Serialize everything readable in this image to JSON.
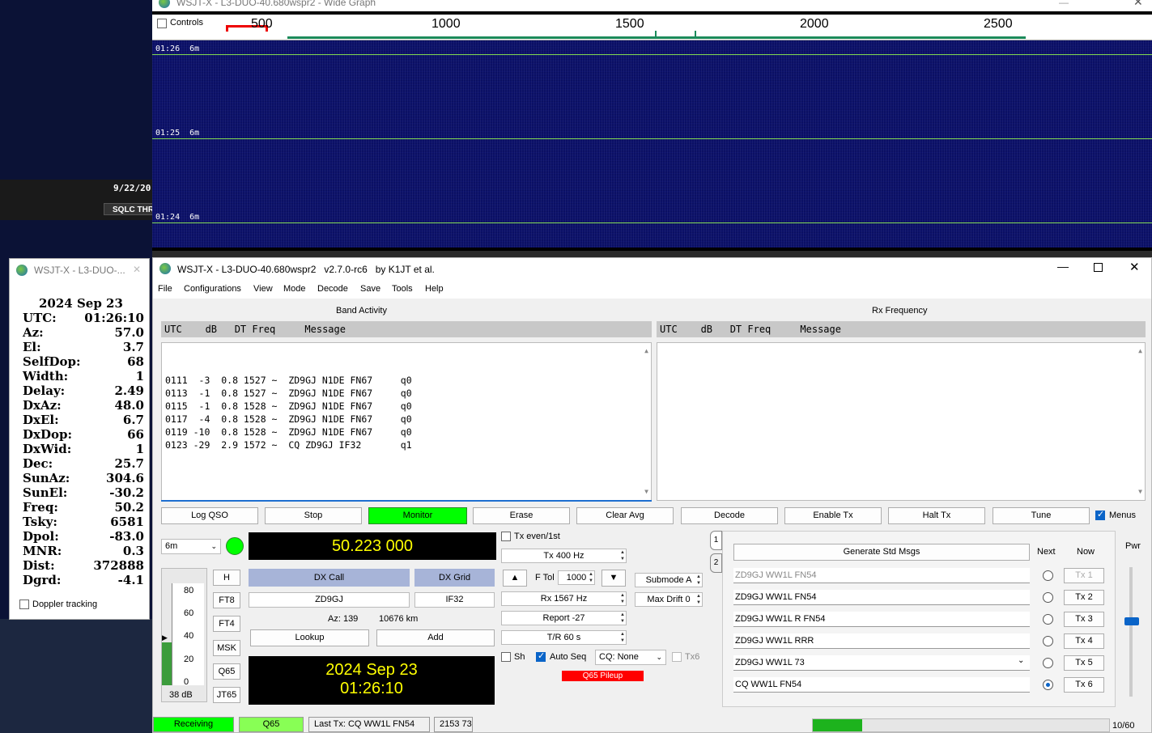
{
  "background": {
    "date_text": "9/22/20",
    "sqlc_text": "SQLC THR"
  },
  "wide_graph": {
    "title": "WSJT-X - L3-DUO-40.680wspr2 - Wide Graph",
    "controls_label": "Controls",
    "scale_labels": [
      "500",
      "1000",
      "1500",
      "2000",
      "2500"
    ],
    "time_rows": [
      {
        "time": "01:26",
        "band": "6m"
      },
      {
        "time": "01:25",
        "band": "6m"
      },
      {
        "time": "01:24",
        "band": "6m"
      }
    ]
  },
  "astro": {
    "title": "WSJT-X - L3-DUO-...",
    "date": "2024 Sep 23",
    "rows": [
      {
        "k": "UTC:",
        "v": "01:26:10"
      },
      {
        "k": "Az:",
        "v": "57.0"
      },
      {
        "k": "El:",
        "v": "3.7"
      },
      {
        "k": "SelfDop:",
        "v": "68"
      },
      {
        "k": "Width:",
        "v": "1"
      },
      {
        "k": "Delay:",
        "v": "2.49"
      },
      {
        "k": "DxAz:",
        "v": "48.0"
      },
      {
        "k": "DxEl:",
        "v": "6.7"
      },
      {
        "k": "DxDop:",
        "v": "66"
      },
      {
        "k": "DxWid:",
        "v": "1"
      },
      {
        "k": "Dec:",
        "v": "25.7"
      },
      {
        "k": "SunAz:",
        "v": "304.6"
      },
      {
        "k": "SunEl:",
        "v": "-30.2"
      },
      {
        "k": "Freq:",
        "v": "50.2"
      },
      {
        "k": "Tsky:",
        "v": "6581"
      },
      {
        "k": "Dpol:",
        "v": "-83.0"
      },
      {
        "k": "MNR:",
        "v": "0.3"
      },
      {
        "k": "Dist:",
        "v": "372888"
      },
      {
        "k": "Dgrd:",
        "v": "-4.1"
      }
    ],
    "doppler_label": "Doppler tracking"
  },
  "main": {
    "title": "WSJT-X - L3-DUO-40.680wspr2   v2.7.0-rc6   by K1JT et al.",
    "menus": [
      "File",
      "Configurations",
      "View",
      "Mode",
      "Decode",
      "Save",
      "Tools",
      "Help"
    ],
    "band_activity": {
      "label": "Band Activity",
      "header": "UTC    dB   DT Freq     Message",
      "rows": [
        "0111  -3  0.8 1527 ~  ZD9GJ N1DE FN67     q0",
        "0113  -1  0.8 1527 ~  ZD9GJ N1DE FN67     q0",
        "0115  -1  0.8 1528 ~  ZD9GJ N1DE FN67     q0",
        "0117  -4  0.8 1528 ~  ZD9GJ N1DE FN67     q0",
        "0119 -10  0.8 1528 ~  ZD9GJ N1DE FN67     q0",
        "0123 -29  2.9 1572 ~  CQ ZD9GJ IF32       q1"
      ]
    },
    "rx_frequency": {
      "label": "Rx Frequency",
      "header": "UTC    dB   DT Freq     Message"
    },
    "buttons": {
      "log_qso": "Log QSO",
      "stop": "Stop",
      "monitor": "Monitor",
      "erase": "Erase",
      "clear_avg": "Clear Avg",
      "decode": "Decode",
      "enable_tx": "Enable Tx",
      "halt_tx": "Halt Tx",
      "tune": "Tune",
      "menus": "Menus"
    },
    "band": "6m",
    "dial_freq": "50.223 000",
    "mode_buttons": [
      "H",
      "FT8",
      "FT4",
      "MSK",
      "Q65",
      "JT65"
    ],
    "meter": {
      "ticks": [
        "80",
        "60",
        "40",
        "20",
        "0"
      ],
      "level_label": "38 dB",
      "level_db": 38
    },
    "dx_call_label": "DX Call",
    "dx_grid_label": "DX Grid",
    "dx_call": "ZD9GJ",
    "dx_grid": "IF32",
    "az_text": "Az: 139",
    "dist_text": "10676 km",
    "lookup": "Lookup",
    "add": "Add",
    "clock_date": "2024 Sep 23",
    "clock_time": "01:26:10",
    "tx_even": "Tx even/1st",
    "tx_freq": "Tx  400  Hz",
    "f_tol_label": "F Tol",
    "f_tol": "1000",
    "rx_freq": "Rx  1567  Hz",
    "report": "Report -27",
    "tr": "T/R  60  s",
    "submode": "Submode A",
    "max_drift": "Max Drift  0",
    "sh": "Sh",
    "auto_seq": "Auto Seq",
    "cq": "CQ: None",
    "tx6_chk": "Tx6",
    "q65_pileup": "Q65 Pileup",
    "tab_labels": [
      "1",
      "2"
    ],
    "generate_std": "Generate Std Msgs",
    "next_label": "Next",
    "now_label": "Now",
    "pwr_label": "Pwr",
    "messages": [
      {
        "text": "ZD9GJ WW1L FN54",
        "btn": "Tx 1"
      },
      {
        "text": "ZD9GJ WW1L FN54",
        "btn": "Tx 2"
      },
      {
        "text": "ZD9GJ WW1L R FN54",
        "btn": "Tx 3"
      },
      {
        "text": "ZD9GJ WW1L RRR",
        "btn": "Tx 4"
      },
      {
        "text": "ZD9GJ WW1L 73",
        "btn": "Tx 5"
      },
      {
        "text": "CQ WW1L FN54",
        "btn": "Tx 6"
      }
    ],
    "status": {
      "receiving": "Receiving",
      "mode": "Q65",
      "last_tx": "Last Tx: CQ WW1L FN54",
      "counts": "2153  73",
      "progress_text": "10/60",
      "progress_fraction": 0.1667
    }
  },
  "colors": {
    "monitor": "#00ff00",
    "pileup": "#ff0000",
    "display_text": "#ffff00",
    "dx_header": "#a7b4d8",
    "waterfall": "#0e1470"
  }
}
